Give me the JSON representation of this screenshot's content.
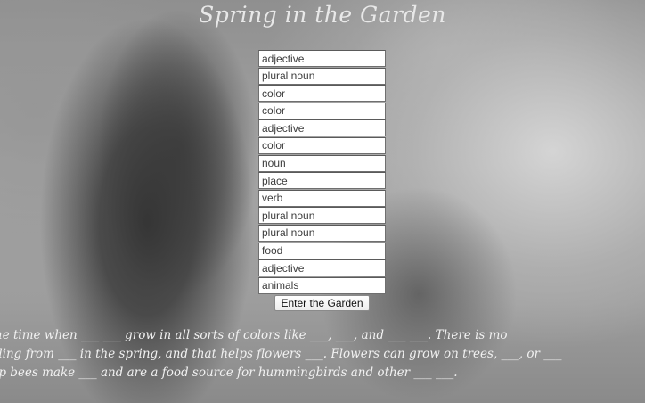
{
  "page": {
    "title": "Spring in the Garden"
  },
  "form": {
    "fields": [
      {
        "placeholder": "adjective"
      },
      {
        "placeholder": "plural noun"
      },
      {
        "placeholder": "color"
      },
      {
        "placeholder": "color"
      },
      {
        "placeholder": "adjective"
      },
      {
        "placeholder": "color"
      },
      {
        "placeholder": "noun"
      },
      {
        "placeholder": "place"
      },
      {
        "placeholder": "verb"
      },
      {
        "placeholder": "plural noun"
      },
      {
        "placeholder": "plural noun"
      },
      {
        "placeholder": "food"
      },
      {
        "placeholder": "adjective"
      },
      {
        "placeholder": "animals"
      }
    ],
    "submit_label": "Enter the Garden"
  },
  "story": {
    "lines": [
      "he time when ___ ___ grow in all sorts of colors like ___, ___, and ___ ___. There is mo",
      "lling from ___ in the spring, and that helps flowers ___. Flowers can grow on trees, ___, or ___",
      "lp bees make ___ and are a food source for hummingbirds and other ___ ___."
    ]
  },
  "colors": {
    "title_text": "#e8e8e8",
    "story_text": "#f1f1f1",
    "field_background": "#ffffff"
  }
}
